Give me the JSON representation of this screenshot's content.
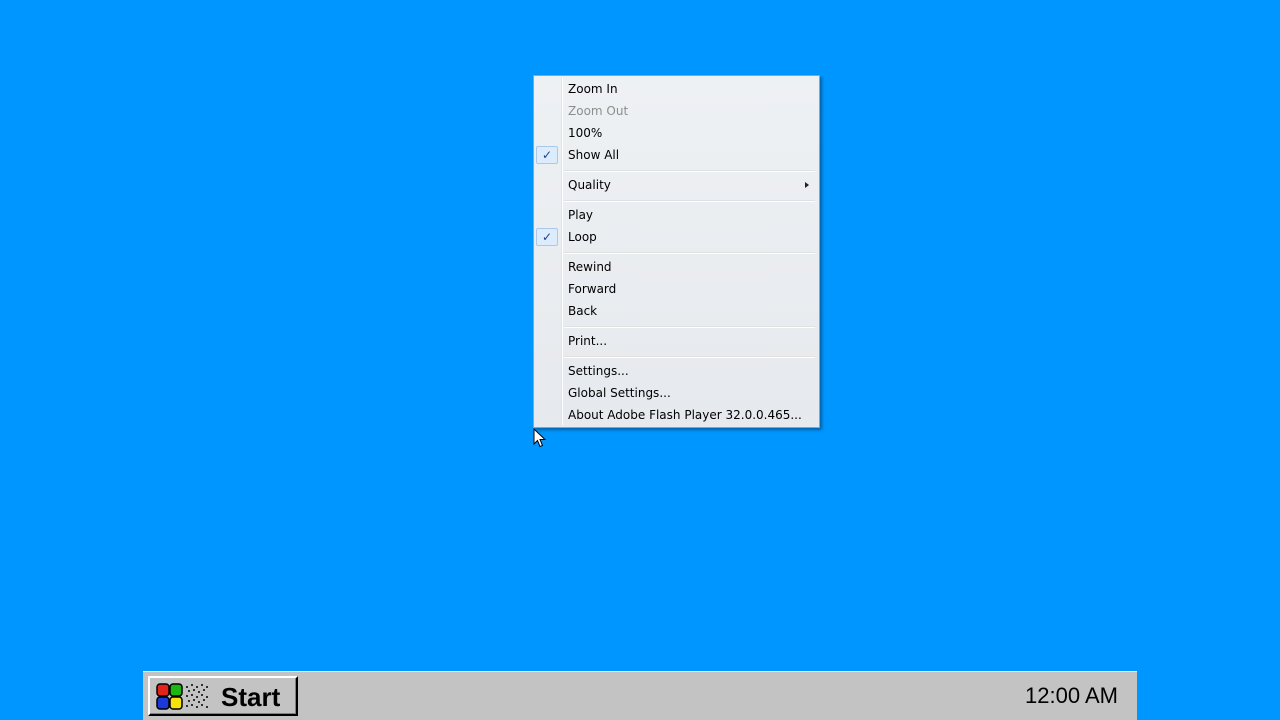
{
  "context_menu": {
    "items": [
      {
        "label": "Zoom In",
        "enabled": true,
        "checked": false,
        "submenu": false
      },
      {
        "label": "Zoom Out",
        "enabled": false,
        "checked": false,
        "submenu": false
      },
      {
        "label": "100%",
        "enabled": true,
        "checked": false,
        "submenu": false
      },
      {
        "label": "Show All",
        "enabled": true,
        "checked": true,
        "submenu": false
      },
      {
        "label": "Quality",
        "enabled": true,
        "checked": false,
        "submenu": true
      },
      {
        "label": "Play",
        "enabled": true,
        "checked": false,
        "submenu": false
      },
      {
        "label": "Loop",
        "enabled": true,
        "checked": true,
        "submenu": false
      },
      {
        "label": "Rewind",
        "enabled": true,
        "checked": false,
        "submenu": false
      },
      {
        "label": "Forward",
        "enabled": true,
        "checked": false,
        "submenu": false
      },
      {
        "label": "Back",
        "enabled": true,
        "checked": false,
        "submenu": false
      },
      {
        "label": "Print...",
        "enabled": true,
        "checked": false,
        "submenu": false
      },
      {
        "label": "Settings...",
        "enabled": true,
        "checked": false,
        "submenu": false
      },
      {
        "label": "Global Settings...",
        "enabled": true,
        "checked": false,
        "submenu": false
      },
      {
        "label": "About Adobe Flash Player 32.0.0.465...",
        "enabled": true,
        "checked": false,
        "submenu": false
      }
    ],
    "check_glyph": "✓",
    "submenu_icon": "submenu-arrow-icon"
  },
  "taskbar": {
    "start_label": "Start",
    "clock": "12:00 AM"
  },
  "colors": {
    "desktop": "#0096ff",
    "taskbar": "#c3c3c3",
    "menu_bg": "#eef1f4",
    "disabled_text": "#8d8d8d"
  },
  "icons": {
    "start_logo": "windows-flag-logo-icon",
    "cursor": "mouse-pointer-icon"
  }
}
